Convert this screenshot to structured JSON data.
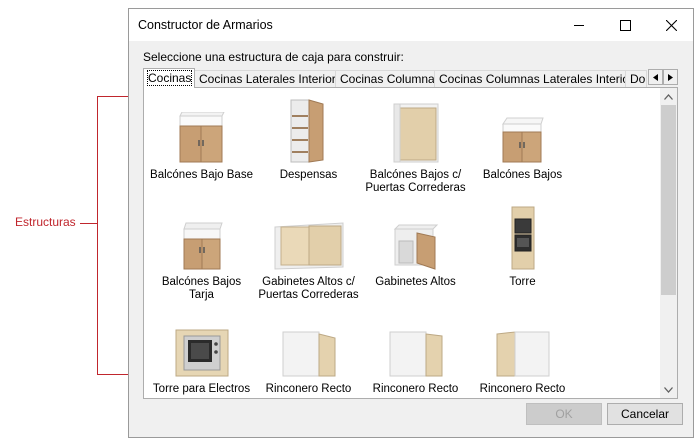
{
  "annotation": {
    "label": "Estructuras",
    "color": "#c0262d"
  },
  "window": {
    "title": "Constructor de Armarios"
  },
  "prompt": "Seleccione una estructura de caja para construir:",
  "tabs": [
    {
      "label": "Cocinas",
      "active": true
    },
    {
      "label": "Cocinas Laterales Interiores"
    },
    {
      "label": "Cocinas Columnas"
    },
    {
      "label": "Cocinas Columnas Laterales Interiores"
    },
    {
      "label": "Dor"
    }
  ],
  "items": [
    {
      "label": "Balcónes Bajo Base",
      "icon": "base-cabinet-icon"
    },
    {
      "label": "Despensas",
      "icon": "pantry-icon"
    },
    {
      "label": "Balcónes Bajos c/ Puertas Correderas",
      "icon": "sliding-door-base-icon"
    },
    {
      "label": "Balcónes Bajos",
      "icon": "base-cabinet-icon"
    },
    {
      "label": "Balcónes Bajos Tarja",
      "icon": "sink-cabinet-icon"
    },
    {
      "label": "Gabinetes Altos c/ Puertas Correderas",
      "icon": "wall-sliding-cabinet-icon"
    },
    {
      "label": "Gabinetes Altos",
      "icon": "wall-cabinet-icon"
    },
    {
      "label": "Torre",
      "icon": "oven-tower-icon"
    },
    {
      "label": "Torre para Electros",
      "icon": "appliance-tower-icon"
    },
    {
      "label": "Rinconero Recto",
      "icon": "corner-cabinet-icon"
    },
    {
      "label": "Rinconero Recto",
      "icon": "corner-cabinet-icon"
    },
    {
      "label": "Rinconero Recto",
      "icon": "corner-cabinet-icon"
    }
  ],
  "buttons": {
    "ok": "OK",
    "cancel": "Cancelar"
  }
}
